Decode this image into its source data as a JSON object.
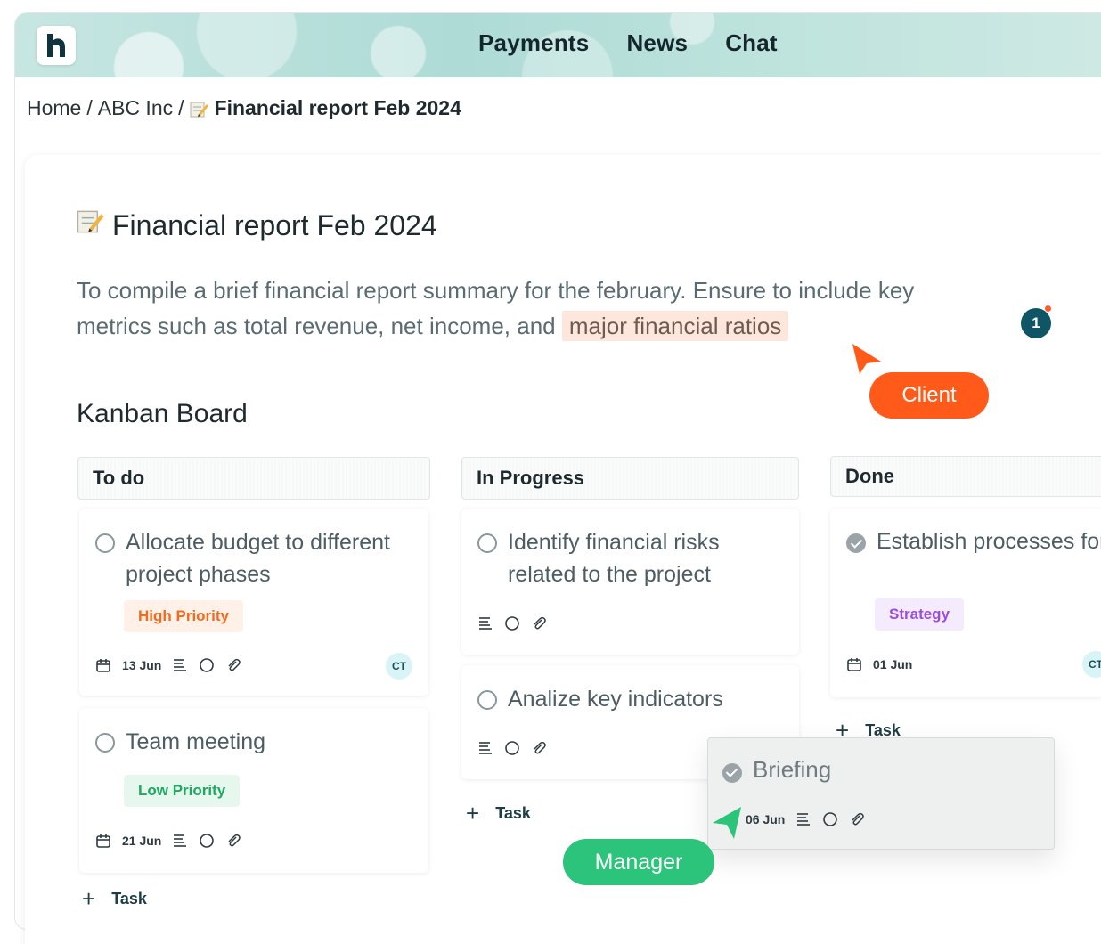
{
  "nav": {
    "items": [
      "Payments",
      "News",
      "Chat"
    ]
  },
  "breadcrumb": {
    "home": "Home",
    "sep": "/",
    "org": "ABC Inc",
    "current": "Financial report Feb 2024"
  },
  "doc": {
    "title": "Financial report Feb 2024",
    "desc_before": "To compile a brief financial report summary for the february. Ensure to include key metrics such as total revenue, net income, and",
    "desc_highlight": "major financial ratios",
    "comment_count": "1"
  },
  "cursors": {
    "client": "Client",
    "manager": "Manager"
  },
  "kanban": {
    "title": "Kanban Board",
    "columns": [
      {
        "name": "To do",
        "tasks": [
          {
            "title": "Allocate budget to different project phases",
            "tag": "High Priority",
            "date": "13 Jun",
            "assignee": "CT"
          },
          {
            "title": "Team meeting",
            "tag": "Low Priority",
            "date": "21 Jun"
          }
        ],
        "add_label": "Task"
      },
      {
        "name": "In Progress",
        "tasks": [
          {
            "title": "Identify financial risks related to the project"
          },
          {
            "title": "Analize key indicators"
          }
        ],
        "add_label": "Task"
      },
      {
        "name": "Done",
        "tasks": [
          {
            "title": "Establish processes for tracking budget",
            "tag": "Strategy",
            "date": "01 Jun",
            "assignee": "CT"
          }
        ],
        "add_label": "Task"
      }
    ],
    "dragging": {
      "title": "Briefing",
      "date": "06 Jun"
    }
  },
  "colors": {
    "client": "#ff5a1a",
    "manager": "#2bc47a",
    "badge": "#0f5566",
    "highlight": "#fde6dc"
  }
}
